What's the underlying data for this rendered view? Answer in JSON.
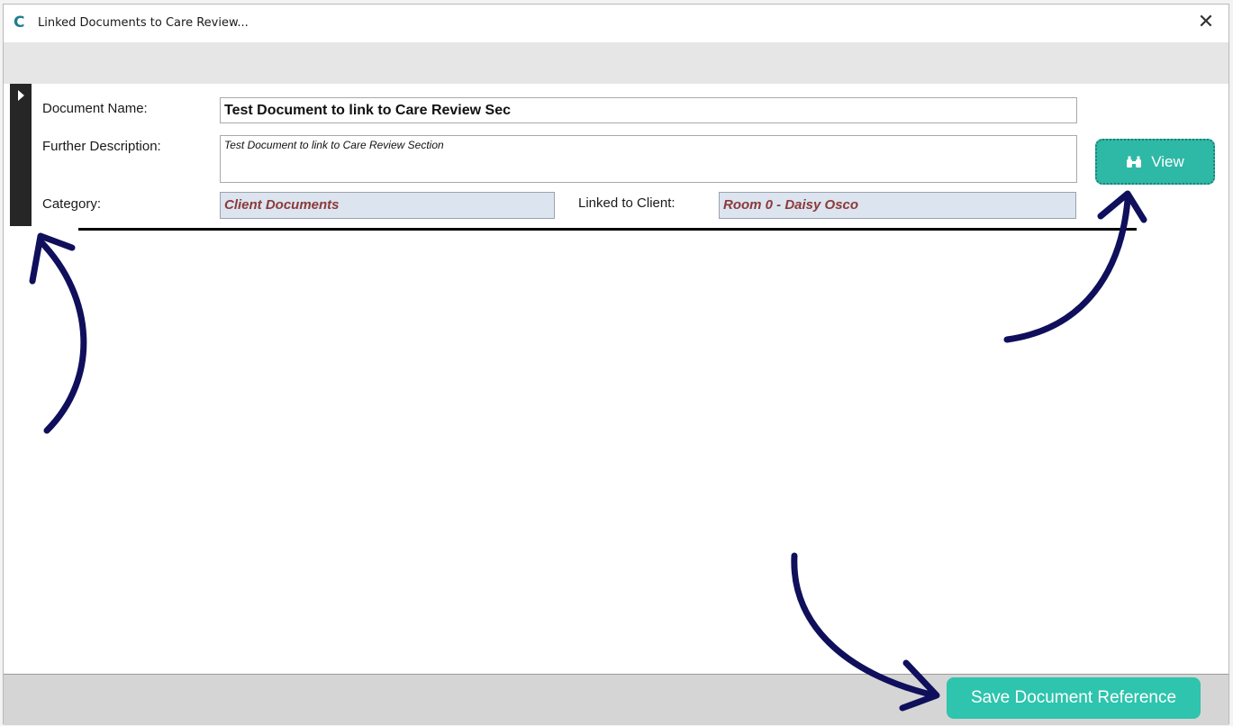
{
  "window": {
    "title": "Linked Documents to Care Review...",
    "logo_letter": "C",
    "close_glyph": "✕"
  },
  "form": {
    "document_name_label": "Document Name:",
    "document_name_value": "Test Document to link to Care Review Sec",
    "further_description_label": "Further Description:",
    "further_description_value": "Test Document to link to Care Review Section",
    "category_label": "Category:",
    "category_value": "Client Documents",
    "linked_client_label": "Linked to Client:",
    "linked_client_value": "Room 0 - Daisy Osco"
  },
  "buttons": {
    "view_label": "View",
    "view_icon": "binoculars-icon",
    "save_label": "Save Document Reference"
  },
  "colors": {
    "accent_teal": "#2eb8a6",
    "readonly_text": "#8b3a3a",
    "annotation_arrow": "#0f0f5c"
  }
}
